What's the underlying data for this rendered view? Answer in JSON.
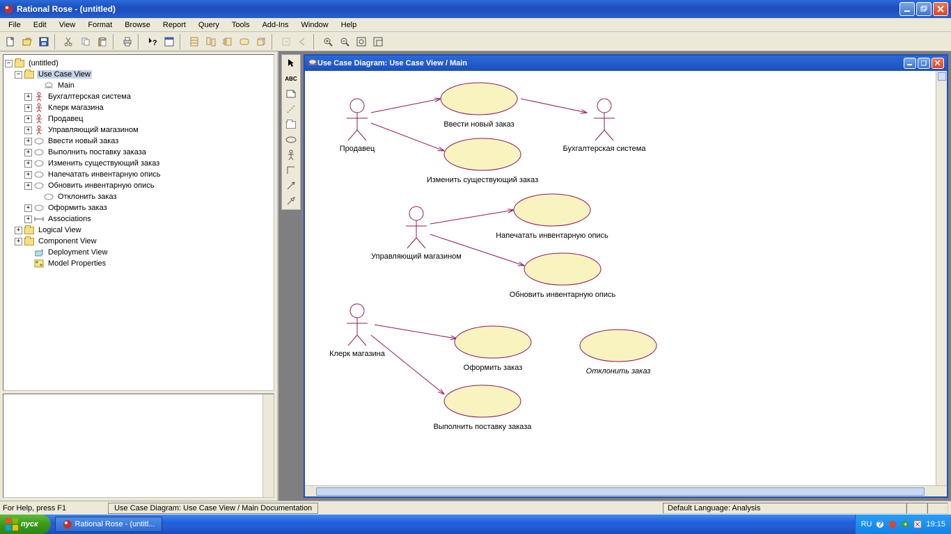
{
  "app": {
    "title": "Rational Rose - (untitled)"
  },
  "menu": [
    "File",
    "Edit",
    "View",
    "Format",
    "Browse",
    "Report",
    "Query",
    "Tools",
    "Add-Ins",
    "Window",
    "Help"
  ],
  "tree": {
    "root": "(untitled)",
    "use_case_view": "Use Case View",
    "main": "Main",
    "actors": [
      "Бухгалтерская система",
      "Клерк магазина",
      "Продавец",
      "Управляющий магазином"
    ],
    "usecases": [
      "Ввести новый заказ",
      "Выполнить поставку заказа",
      "Изменить существующий заказ",
      "Напечатать инвентарную опись",
      "Обновить инвентарную опись",
      "Отклонить заказ",
      "Оформить заказ"
    ],
    "assoc": "Associations",
    "logical": "Logical View",
    "component": "Component View",
    "deployment": "Deployment View",
    "modelprops": "Model Properties"
  },
  "inner": {
    "title": "Use Case Diagram: Use Case View / Main"
  },
  "diagram": {
    "actors": {
      "a1": "Продавец",
      "a2": "Бухгалтерская система",
      "a3": "Управляющий магазином",
      "a4": "Клерк магазина"
    },
    "usecases": {
      "u1": "Ввести новый заказ",
      "u2": "Изменить существующий заказ",
      "u3": "Напечатать инвентарную опись",
      "u4": "Обновить инвентарную опись",
      "u5": "Оформить заказ",
      "u6": "Отклонить заказ",
      "u7": "Выполнить поставку заказа"
    }
  },
  "status": {
    "help": "For Help, press F1",
    "doc_tab": "Use Case Diagram: Use Case View / Main Documentation",
    "lang": "Default Language: Analysis"
  },
  "taskbar": {
    "start": "пуск",
    "task1": "Rational Rose - (untitl...",
    "lang": "RU",
    "clock": "19:15"
  },
  "palette_abc": "ABC"
}
